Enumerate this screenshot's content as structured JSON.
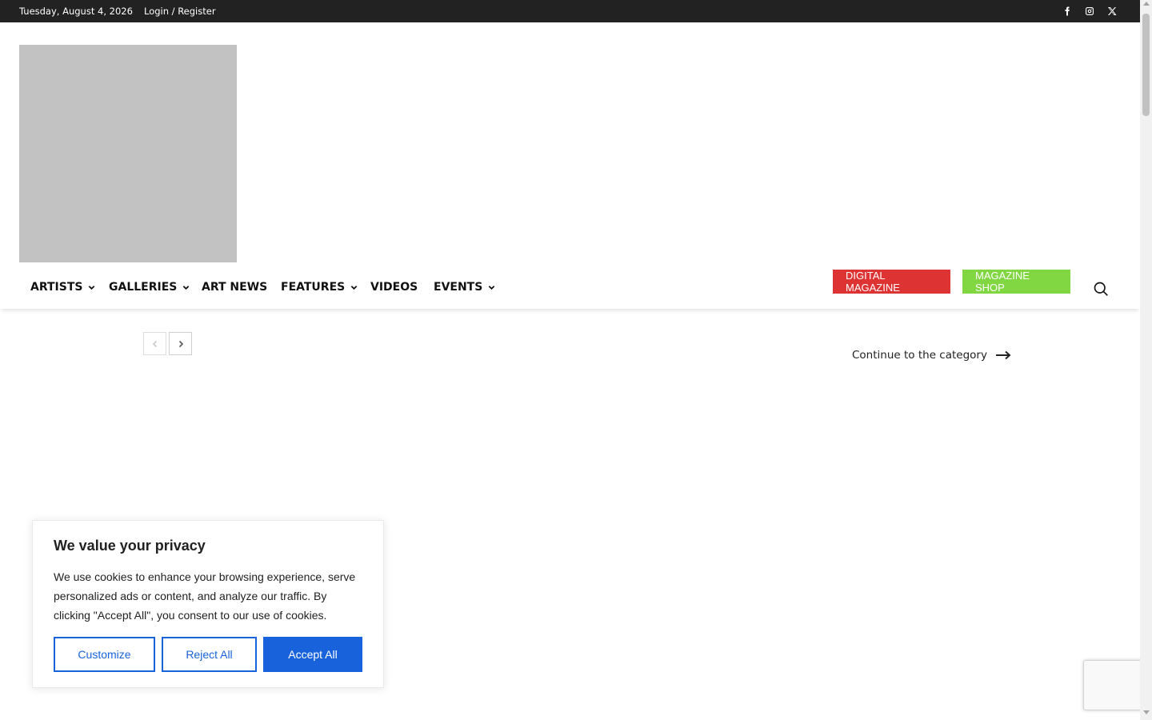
{
  "topbar": {
    "date": "Tuesday, August 4, 2026",
    "login": "Login / Register",
    "social_icons": [
      "facebook-icon",
      "instagram-icon",
      "x-twitter-icon"
    ]
  },
  "nav": {
    "items": [
      {
        "label": "ARTISTS",
        "has_dropdown": true
      },
      {
        "label": "GALLERIES",
        "has_dropdown": true
      },
      {
        "label": "ART NEWS",
        "has_dropdown": false
      },
      {
        "label": "FEATURES",
        "has_dropdown": true
      },
      {
        "label": "VIDEOS",
        "has_dropdown": false
      },
      {
        "label": "EVENTS",
        "has_dropdown": true
      }
    ],
    "digital_magazine": "DIGITAL MAGAZINE",
    "magazine_shop": "MAGAZINE SHOP",
    "colors": {
      "digital_magazine": "#dd3333",
      "magazine_shop": "#81d742"
    }
  },
  "slider": {
    "continue_label": "Continue to the category"
  },
  "cookie": {
    "title": "We value your privacy",
    "text": "We use cookies to enhance your browsing experience, serve personalized ads or content, and analyze our traffic. By clicking \"Accept All\", you consent to our use of cookies.",
    "customize": "Customize",
    "reject": "Reject All",
    "accept": "Accept All",
    "accent_color": "#1863dc"
  }
}
